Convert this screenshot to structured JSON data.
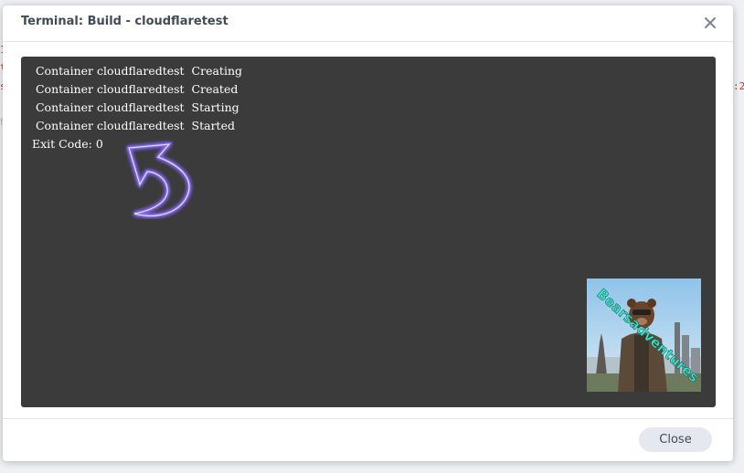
{
  "dialog": {
    "title": "Terminal: Build - cloudflaretest",
    "close_glyph": "✕"
  },
  "terminal": {
    "lines": [
      " Container cloudflaredtest  Creating",
      " Container cloudflaredtest  Created",
      " Container cloudflaredtest  Starting",
      " Container cloudflaredtest  Started",
      "Exit Code: 0"
    ]
  },
  "overlay": {
    "arrow_icon": "curved-arrow-icon",
    "watermark_text": "Bearsadventures"
  },
  "footer": {
    "close_label": "Close"
  },
  "background": {
    "frag1": "1",
    "frag2": "t",
    "frag3": "s",
    "frag4": "f",
    "frag5": ":2"
  },
  "colors": {
    "terminal_bg": "#3b3b3b",
    "terminal_text": "#ffffff",
    "arrow_glow": "#8a6cff",
    "watermark": "#3ee0c8",
    "button_bg": "#e5e9ef"
  }
}
